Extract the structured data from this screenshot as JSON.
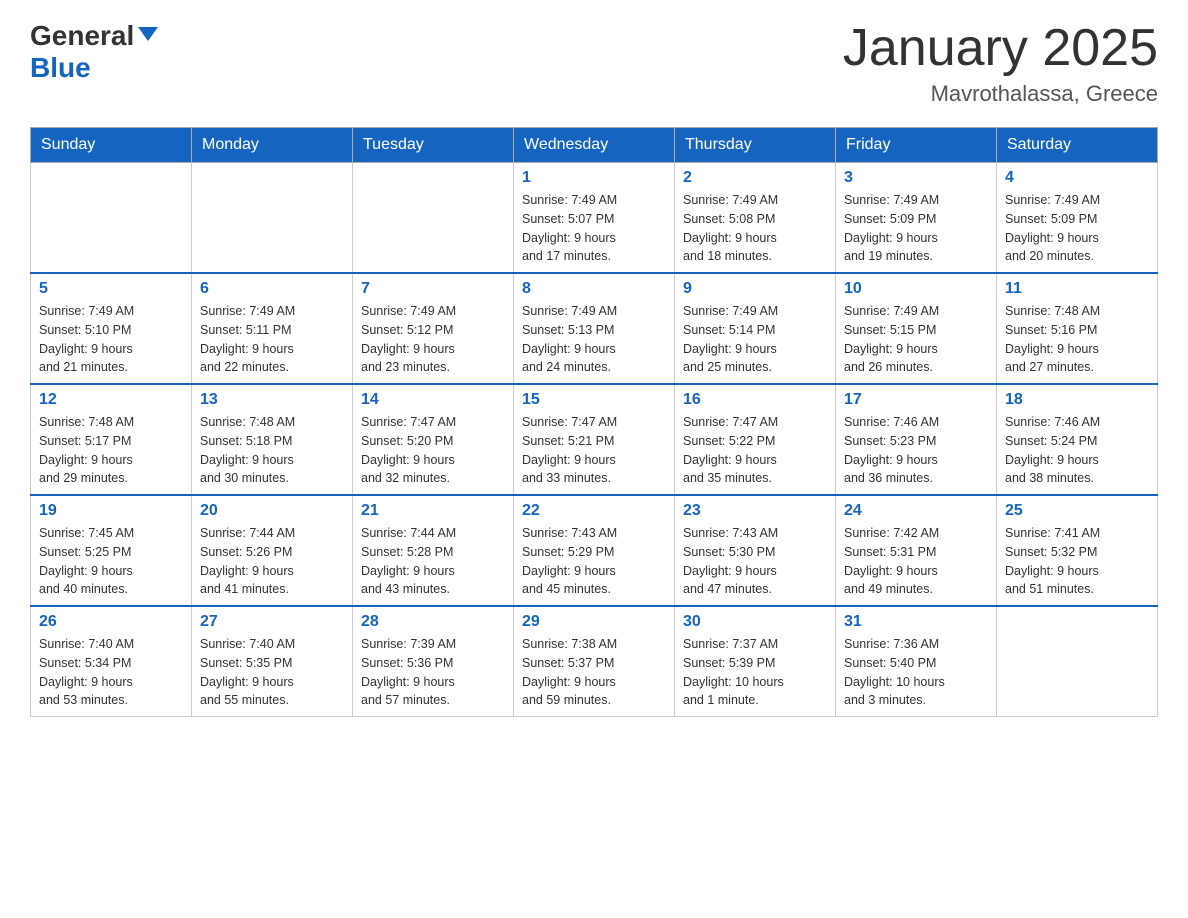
{
  "logo": {
    "general": "General",
    "blue": "Blue"
  },
  "title": "January 2025",
  "subtitle": "Mavrothalassa, Greece",
  "days": {
    "headers": [
      "Sunday",
      "Monday",
      "Tuesday",
      "Wednesday",
      "Thursday",
      "Friday",
      "Saturday"
    ]
  },
  "weeks": [
    {
      "cells": [
        {
          "day": "",
          "info": ""
        },
        {
          "day": "",
          "info": ""
        },
        {
          "day": "",
          "info": ""
        },
        {
          "day": "1",
          "info": "Sunrise: 7:49 AM\nSunset: 5:07 PM\nDaylight: 9 hours\nand 17 minutes."
        },
        {
          "day": "2",
          "info": "Sunrise: 7:49 AM\nSunset: 5:08 PM\nDaylight: 9 hours\nand 18 minutes."
        },
        {
          "day": "3",
          "info": "Sunrise: 7:49 AM\nSunset: 5:09 PM\nDaylight: 9 hours\nand 19 minutes."
        },
        {
          "day": "4",
          "info": "Sunrise: 7:49 AM\nSunset: 5:09 PM\nDaylight: 9 hours\nand 20 minutes."
        }
      ]
    },
    {
      "cells": [
        {
          "day": "5",
          "info": "Sunrise: 7:49 AM\nSunset: 5:10 PM\nDaylight: 9 hours\nand 21 minutes."
        },
        {
          "day": "6",
          "info": "Sunrise: 7:49 AM\nSunset: 5:11 PM\nDaylight: 9 hours\nand 22 minutes."
        },
        {
          "day": "7",
          "info": "Sunrise: 7:49 AM\nSunset: 5:12 PM\nDaylight: 9 hours\nand 23 minutes."
        },
        {
          "day": "8",
          "info": "Sunrise: 7:49 AM\nSunset: 5:13 PM\nDaylight: 9 hours\nand 24 minutes."
        },
        {
          "day": "9",
          "info": "Sunrise: 7:49 AM\nSunset: 5:14 PM\nDaylight: 9 hours\nand 25 minutes."
        },
        {
          "day": "10",
          "info": "Sunrise: 7:49 AM\nSunset: 5:15 PM\nDaylight: 9 hours\nand 26 minutes."
        },
        {
          "day": "11",
          "info": "Sunrise: 7:48 AM\nSunset: 5:16 PM\nDaylight: 9 hours\nand 27 minutes."
        }
      ]
    },
    {
      "cells": [
        {
          "day": "12",
          "info": "Sunrise: 7:48 AM\nSunset: 5:17 PM\nDaylight: 9 hours\nand 29 minutes."
        },
        {
          "day": "13",
          "info": "Sunrise: 7:48 AM\nSunset: 5:18 PM\nDaylight: 9 hours\nand 30 minutes."
        },
        {
          "day": "14",
          "info": "Sunrise: 7:47 AM\nSunset: 5:20 PM\nDaylight: 9 hours\nand 32 minutes."
        },
        {
          "day": "15",
          "info": "Sunrise: 7:47 AM\nSunset: 5:21 PM\nDaylight: 9 hours\nand 33 minutes."
        },
        {
          "day": "16",
          "info": "Sunrise: 7:47 AM\nSunset: 5:22 PM\nDaylight: 9 hours\nand 35 minutes."
        },
        {
          "day": "17",
          "info": "Sunrise: 7:46 AM\nSunset: 5:23 PM\nDaylight: 9 hours\nand 36 minutes."
        },
        {
          "day": "18",
          "info": "Sunrise: 7:46 AM\nSunset: 5:24 PM\nDaylight: 9 hours\nand 38 minutes."
        }
      ]
    },
    {
      "cells": [
        {
          "day": "19",
          "info": "Sunrise: 7:45 AM\nSunset: 5:25 PM\nDaylight: 9 hours\nand 40 minutes."
        },
        {
          "day": "20",
          "info": "Sunrise: 7:44 AM\nSunset: 5:26 PM\nDaylight: 9 hours\nand 41 minutes."
        },
        {
          "day": "21",
          "info": "Sunrise: 7:44 AM\nSunset: 5:28 PM\nDaylight: 9 hours\nand 43 minutes."
        },
        {
          "day": "22",
          "info": "Sunrise: 7:43 AM\nSunset: 5:29 PM\nDaylight: 9 hours\nand 45 minutes."
        },
        {
          "day": "23",
          "info": "Sunrise: 7:43 AM\nSunset: 5:30 PM\nDaylight: 9 hours\nand 47 minutes."
        },
        {
          "day": "24",
          "info": "Sunrise: 7:42 AM\nSunset: 5:31 PM\nDaylight: 9 hours\nand 49 minutes."
        },
        {
          "day": "25",
          "info": "Sunrise: 7:41 AM\nSunset: 5:32 PM\nDaylight: 9 hours\nand 51 minutes."
        }
      ]
    },
    {
      "cells": [
        {
          "day": "26",
          "info": "Sunrise: 7:40 AM\nSunset: 5:34 PM\nDaylight: 9 hours\nand 53 minutes."
        },
        {
          "day": "27",
          "info": "Sunrise: 7:40 AM\nSunset: 5:35 PM\nDaylight: 9 hours\nand 55 minutes."
        },
        {
          "day": "28",
          "info": "Sunrise: 7:39 AM\nSunset: 5:36 PM\nDaylight: 9 hours\nand 57 minutes."
        },
        {
          "day": "29",
          "info": "Sunrise: 7:38 AM\nSunset: 5:37 PM\nDaylight: 9 hours\nand 59 minutes."
        },
        {
          "day": "30",
          "info": "Sunrise: 7:37 AM\nSunset: 5:39 PM\nDaylight: 10 hours\nand 1 minute."
        },
        {
          "day": "31",
          "info": "Sunrise: 7:36 AM\nSunset: 5:40 PM\nDaylight: 10 hours\nand 3 minutes."
        },
        {
          "day": "",
          "info": ""
        }
      ]
    }
  ]
}
